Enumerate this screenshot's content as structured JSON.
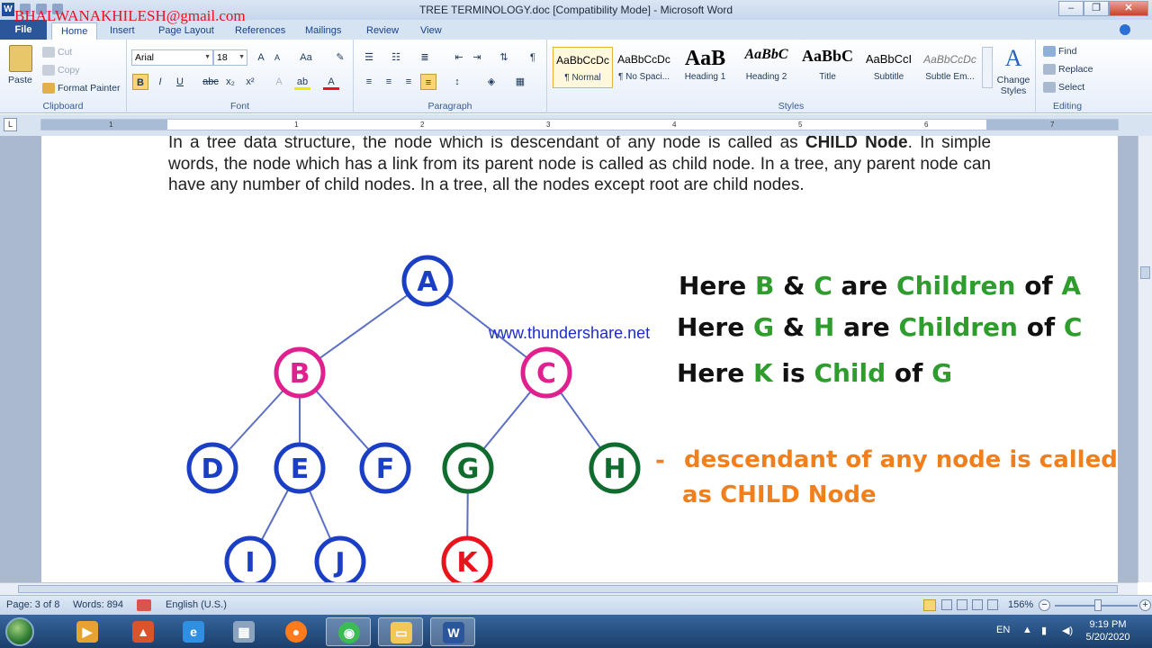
{
  "window": {
    "title": "TREE TERMINOLOGY.doc [Compatibility Mode] - Microsoft Word",
    "overlay_email": "BHALWANAKHILESH@gmail.com",
    "controls": [
      "–",
      "❐",
      "✕"
    ]
  },
  "ribbon": {
    "tabs": [
      "File",
      "Home",
      "Insert",
      "Page Layout",
      "References",
      "Mailings",
      "Review",
      "View"
    ],
    "clipboard": {
      "paste": "Paste",
      "cut": "Cut",
      "copy": "Copy",
      "format_painter": "Format Painter",
      "label": "Clipboard"
    },
    "font": {
      "name": "Arial",
      "size": "18",
      "label": "Font",
      "buttons": [
        "B",
        "I",
        "U",
        "abc",
        "x₂",
        "x²"
      ]
    },
    "paragraph": {
      "label": "Paragraph"
    },
    "styles": {
      "label": "Styles",
      "items": [
        {
          "sample": "AaBbCcDc",
          "name": "¶ Normal"
        },
        {
          "sample": "AaBbCcDc",
          "name": "¶ No Spaci..."
        },
        {
          "sample": "AaB",
          "name": "Heading 1"
        },
        {
          "sample": "AaBbC",
          "name": "Heading 2"
        },
        {
          "sample": "AaBbC",
          "name": "Title"
        },
        {
          "sample": "AaBbCcI",
          "name": "Subtitle"
        },
        {
          "sample": "AaBbCcDc",
          "name": "Subtle Em..."
        }
      ],
      "change_styles": "Change Styles"
    },
    "editing": {
      "label": "Editing",
      "find": "Find",
      "replace": "Replace",
      "select": "Select"
    }
  },
  "ruler": {
    "numbers": [
      "1",
      "1",
      "2",
      "3",
      "4",
      "5",
      "6",
      "7"
    ]
  },
  "document": {
    "paragraph_before": "In a tree data structure, the node which is descendant of any node is called as ",
    "paragraph_bold": "CHILD Node",
    "paragraph_after": ". In simple words, the node which has a link from its parent node is called as child node. In a tree, any parent node can have any number of child nodes. In a tree, all the nodes except root are child nodes.",
    "watermark": "www.thundershare.net",
    "tree": {
      "nodes": [
        {
          "id": "A",
          "color": "#1a3fc4"
        },
        {
          "id": "B",
          "color": "#e0208f"
        },
        {
          "id": "C",
          "color": "#e0208f"
        },
        {
          "id": "D",
          "color": "#1a3fc4"
        },
        {
          "id": "E",
          "color": "#1a3fc4"
        },
        {
          "id": "F",
          "color": "#1a3fc4"
        },
        {
          "id": "G",
          "color": "#0f6b2e"
        },
        {
          "id": "H",
          "color": "#0f6b2e"
        },
        {
          "id": "I",
          "color": "#1a3fc4"
        },
        {
          "id": "J",
          "color": "#1a3fc4"
        },
        {
          "id": "K",
          "color": "#e8141b"
        }
      ],
      "edges": [
        [
          "A",
          "B"
        ],
        [
          "A",
          "C"
        ],
        [
          "B",
          "D"
        ],
        [
          "B",
          "E"
        ],
        [
          "B",
          "F"
        ],
        [
          "C",
          "G"
        ],
        [
          "C",
          "H"
        ],
        [
          "E",
          "I"
        ],
        [
          "E",
          "J"
        ],
        [
          "G",
          "K"
        ]
      ]
    },
    "notes": [
      [
        {
          "t": "Here ",
          "c": "black"
        },
        {
          "t": "B",
          "c": "green"
        },
        {
          "t": " & ",
          "c": "black"
        },
        {
          "t": "C",
          "c": "green"
        },
        {
          "t": " are ",
          "c": "black"
        },
        {
          "t": "Children",
          "c": "green"
        },
        {
          "t": " of ",
          "c": "black"
        },
        {
          "t": "A",
          "c": "green"
        }
      ],
      [
        {
          "t": "Here ",
          "c": "black"
        },
        {
          "t": "G",
          "c": "green"
        },
        {
          "t": " & ",
          "c": "black"
        },
        {
          "t": "H",
          "c": "green"
        },
        {
          "t": " are ",
          "c": "black"
        },
        {
          "t": "Children",
          "c": "green"
        },
        {
          "t": " of ",
          "c": "black"
        },
        {
          "t": "C",
          "c": "green"
        }
      ],
      [
        {
          "t": "Here ",
          "c": "black"
        },
        {
          "t": "K",
          "c": "green"
        },
        {
          "t": " is ",
          "c": "black"
        },
        {
          "t": "Child",
          "c": "green"
        },
        {
          "t": " of ",
          "c": "black"
        },
        {
          "t": "G",
          "c": "green"
        }
      ]
    ],
    "definition_dash": "-",
    "definition_line1": "descendant of any node is called",
    "definition_line2": "as CHILD Node",
    "colors": {
      "green": "#2e9d2e",
      "black": "#111111",
      "orange": "#f07f1e"
    }
  },
  "statusbar": {
    "page": "Page: 3 of 8",
    "words": "Words: 894",
    "language": "English (U.S.)",
    "zoom": "156%"
  },
  "taskbar": {
    "tray_lang": "EN",
    "time": "9:19 PM",
    "date": "5/20/2020"
  }
}
